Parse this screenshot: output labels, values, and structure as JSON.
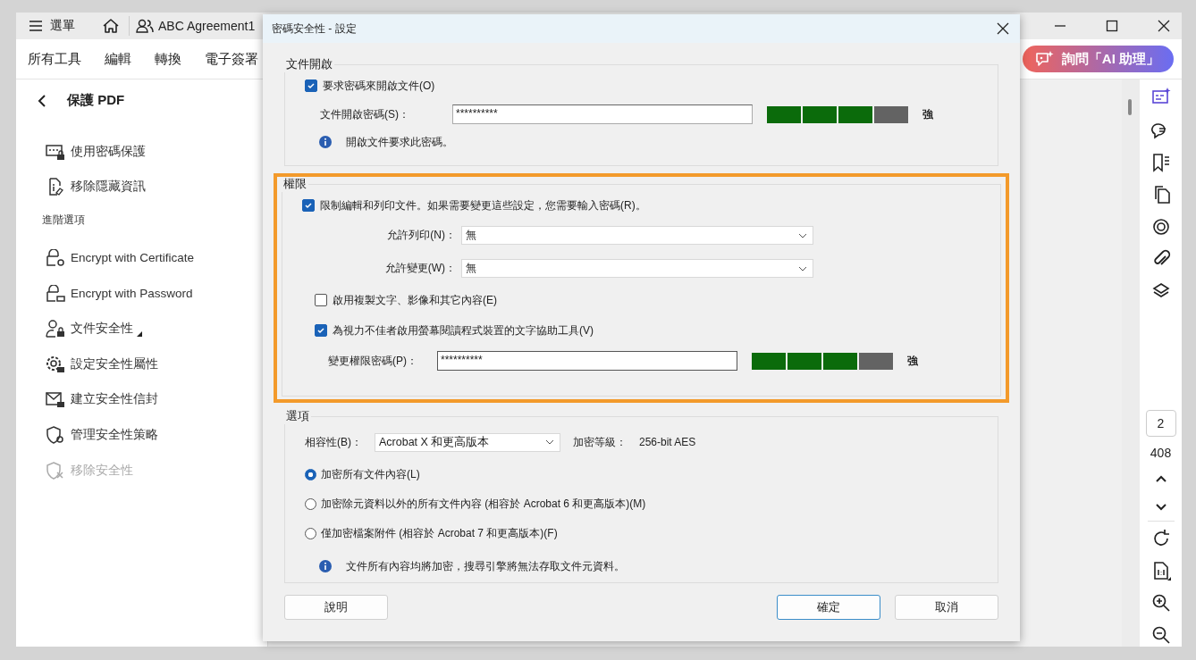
{
  "top_bar": {
    "menu_label": "選單",
    "document_tab": "ABC Agreement1"
  },
  "menu_tabs": [
    "所有工具",
    "編輯",
    "轉換",
    "電子簽署"
  ],
  "ai_button": "詢問「AI 助理」",
  "sidebar": {
    "title": "保護 PDF",
    "items": [
      {
        "label": "使用密碼保護",
        "disabled": false,
        "submenu": false
      },
      {
        "label": "移除隱藏資訊",
        "disabled": false,
        "submenu": false
      }
    ],
    "section_label": "進階選項",
    "advanced_items": [
      {
        "label": "Encrypt with Certificate",
        "disabled": false,
        "submenu": false
      },
      {
        "label": "Encrypt with Password",
        "disabled": false,
        "submenu": false
      },
      {
        "label": "文件安全性",
        "disabled": false,
        "submenu": true
      },
      {
        "label": "設定安全性屬性",
        "disabled": false,
        "submenu": false
      },
      {
        "label": "建立安全性信封",
        "disabled": false,
        "submenu": false
      },
      {
        "label": "管理安全性策略",
        "disabled": false,
        "submenu": false
      },
      {
        "label": "移除安全性",
        "disabled": true,
        "submenu": false
      }
    ]
  },
  "page_nav": {
    "page": "2",
    "total": "408"
  },
  "dialog": {
    "title": "密碼安全性 - 設定",
    "open_group": {
      "title": "文件開啟",
      "require": {
        "label": "要求密碼來開啟文件(O)",
        "checked": true
      },
      "password": {
        "label": "文件開啟密碼(S)：",
        "value": "**********",
        "level": 0.75,
        "strength": "強"
      },
      "info": "開啟文件要求此密碼。"
    },
    "permissions_group": {
      "title": "權限",
      "highlighted": true,
      "restrict": {
        "label": "限制編輯和列印文件。如果需要變更這些設定，您需要輸入密碼(R)。",
        "checked": true
      },
      "selects": [
        {
          "label": "允許列印(N)：",
          "value": "無"
        },
        {
          "label": "允許變更(W)：",
          "value": "無"
        }
      ],
      "options": [
        {
          "label": "啟用複製文字、影像和其它內容(E)",
          "checked": false
        },
        {
          "label": "為視力不佳者啟用螢幕閱讀程式裝置的文字協助工具(V)",
          "checked": true
        }
      ],
      "password": {
        "label": "變更權限密碼(P)：",
        "value": "**********",
        "level": 0.75,
        "strength": "強"
      }
    },
    "options_group": {
      "title": "選項",
      "compat": {
        "label": "相容性(B)：",
        "value": "Acrobat X 和更高版本"
      },
      "level_label": "加密等級：",
      "level_value": "256-bit AES",
      "radios": [
        {
          "label": "加密所有文件內容(L)",
          "selected": true
        },
        {
          "label": "加密除元資料以外的所有文件內容 (相容於 Acrobat 6 和更高版本)(M)",
          "selected": false
        },
        {
          "label": "僅加密檔案附件 (相容於 Acrobat 7 和更高版本)(F)",
          "selected": false
        }
      ],
      "info": "文件所有內容均將加密，搜尋引擎將無法存取文件元資料。"
    },
    "buttons": [
      {
        "label": "說明",
        "default": false
      },
      {
        "label": "確定",
        "default": true
      },
      {
        "label": "取消",
        "default": false
      }
    ]
  }
}
